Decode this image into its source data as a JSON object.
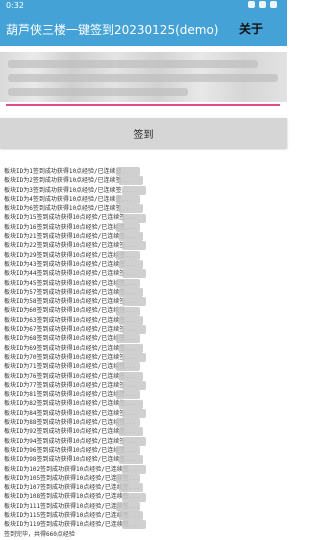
{
  "status_bar": {
    "time": "0:32"
  },
  "app_bar": {
    "title": "葫芦侠三楼一键签到20230125(demo)",
    "about_label": "关于"
  },
  "checkin_button": {
    "label": "签到"
  },
  "log_lines": [
    "板块ID为1签到成功获得10点经验/已连续签...",
    "板块ID为2签到成功获得10点经验/已连续签...",
    "板块ID为3签到成功获得10点经验/已连续签...",
    "板块ID为4签到成功获得10点经验/已连续签...",
    "板块ID为6签到成功获得10点经验/已连续签...",
    "板块ID为15签到成功获得10点经验/已连续签...",
    "板块ID为16签到成功获得10点经验/已连续签...",
    "板块ID为21签到成功获得10点经验/已连续签...",
    "板块ID为22签到成功获得10点经验/已连续签...",
    "板块ID为29签到成功获得10点经验/已连续签...",
    "板块ID为43签到成功获得10点经验/已连续签...",
    "板块ID为44签到成功获得10点经验/已连续签...",
    "板块ID为45签到成功获得10点经验/已连续签...",
    "板块ID为57签到成功获得10点经验/已连续签...",
    "板块ID为58签到成功获得10点经验/已连续签...",
    "板块ID为60签到成功获得10点经验/已连续签...",
    "板块ID为63签到成功获得10点经验/已连续签...",
    "板块ID为67签到成功获得10点经验/已连续签...",
    "板块ID为68签到成功获得10点经验/已连续签...",
    "板块ID为69签到成功获得10点经验/已连续签...",
    "板块ID为70签到成功获得10点经验/已连续签...",
    "板块ID为71签到成功获得10点经验/已连续签...",
    "板块ID为76签到成功获得10点经验/已连续签...",
    "板块ID为77签到成功获得10点经验/已连续签...",
    "板块ID为81签到成功获得10点经验/已连续签...",
    "板块ID为82签到成功获得10点经验/已连续签...",
    "板块ID为84签到成功获得10点经验/已连续签...",
    "板块ID为88签到成功获得10点经验/已连续签...",
    "板块ID为92签到成功获得10点经验/已连续签...",
    "板块ID为94签到成功获得10点经验/已连续签...",
    "板块ID为96签到成功获得10点经验/已连续签...",
    "板块ID为98签到成功获得10点经验/已连续签...",
    "板块ID为102签到成功获得10点经验/已连续签...",
    "板块ID为105签到成功获得10点经验/已连续签...",
    "板块ID为107签到成功获得10点经验/已连续签...",
    "板块ID为108签到成功获得10点经验/已连续签...",
    "板块ID为111签到成功获得10点经验/已连续签...",
    "板块ID为115签到成功获得10点经验/已连续签...",
    "板块ID为119签到成功获得10点经验/已连续签...",
    "签到完毕，共得660点经验"
  ]
}
